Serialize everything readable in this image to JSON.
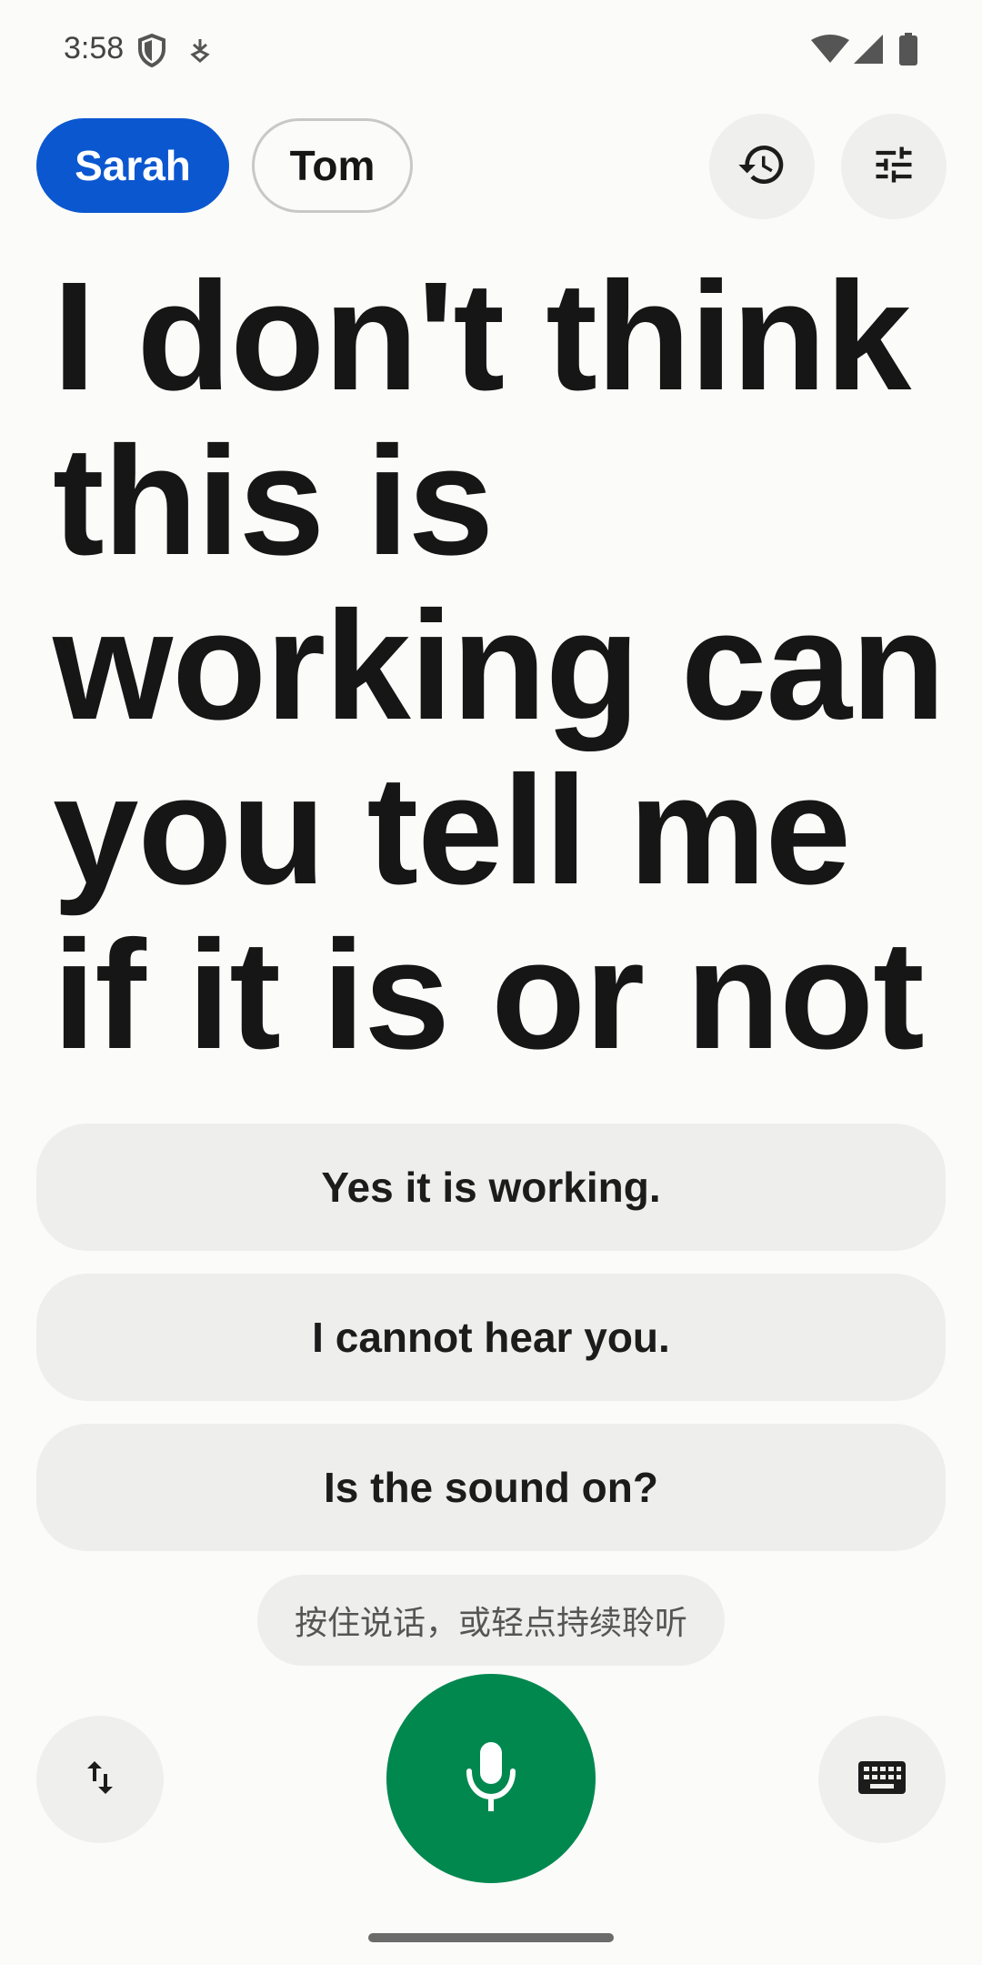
{
  "status_bar": {
    "time": "3:58",
    "icons": [
      "shield-icon",
      "download-icon",
      "wifi-icon",
      "cellular-signal-icon",
      "battery-icon"
    ]
  },
  "speakers": {
    "active": "Sarah",
    "inactive": "Tom"
  },
  "toolbar": {
    "icons": [
      "history-icon",
      "settings-sliders-icon"
    ]
  },
  "transcript": {
    "text": "I don't think this is working can you tell me if it is or not"
  },
  "suggested_replies": [
    {
      "label": "Yes it is working."
    },
    {
      "label": "I cannot hear you."
    },
    {
      "label": "Is the sound on?"
    }
  ],
  "hint": {
    "text": "按住说话，或轻点持续聆听"
  },
  "bottom_bar": {
    "icons": [
      "swap-vertical-icon",
      "microphone-icon",
      "keyboard-icon"
    ]
  },
  "colors": {
    "background": "#fbfbf9",
    "accent_blue": "#0b57d0",
    "mic_green": "#01884f",
    "button_gray": "#efefed"
  }
}
